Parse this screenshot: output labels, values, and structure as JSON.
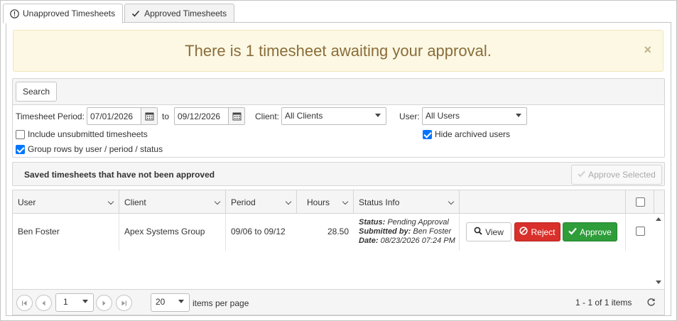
{
  "tabs": [
    {
      "label": "Unapproved Timesheets",
      "icon": "exclamation-circle-icon",
      "active": true
    },
    {
      "label": "Approved Timesheets",
      "icon": "checkmark-icon",
      "active": false
    }
  ],
  "alert": {
    "message": "There is 1 timesheet awaiting your approval.",
    "close": "×"
  },
  "filters": {
    "search_label": "Search",
    "period_label": "Timesheet Period:",
    "from_date": "07/01/2026",
    "to_label": "to",
    "to_date": "09/12/2026",
    "client_label": "Client:",
    "client_value": "All Clients",
    "user_label": "User:",
    "user_value": "All Users",
    "include_unsubmitted_label": "Include unsubmitted timesheets",
    "include_unsubmitted": false,
    "group_rows_label": "Group rows by user / period / status",
    "group_rows": true,
    "hide_archived_label": "Hide archived users",
    "hide_archived": true
  },
  "saved": {
    "title": "Saved timesheets that have not been approved",
    "approve_selected_label": "Approve Selected"
  },
  "grid": {
    "columns": [
      "User",
      "Client",
      "Period",
      "Hours",
      "Status Info"
    ],
    "rows": [
      {
        "user": "Ben Foster",
        "client": "Apex Systems Group",
        "period": "09/06 to 09/12",
        "hours": "28.50",
        "status_label": "Status:",
        "status_value": "Pending Approval",
        "submitted_label": "Submitted by:",
        "submitted_value": "Ben Foster",
        "date_label": "Date:",
        "date_value": "08/23/2026 07:24 PM",
        "view_label": "View",
        "reject_label": "Reject",
        "approve_label": "Approve"
      }
    ]
  },
  "pager": {
    "page": "1",
    "page_size": "20",
    "items_per_page_label": "items per page",
    "summary": "1 - 1 of 1 items"
  },
  "colors": {
    "alert_bg": "#fcf8e3",
    "alert_text": "#8a6d3b",
    "reject": "#d9302b",
    "approve": "#2e9d3a",
    "checkbox": "#0075ff"
  }
}
